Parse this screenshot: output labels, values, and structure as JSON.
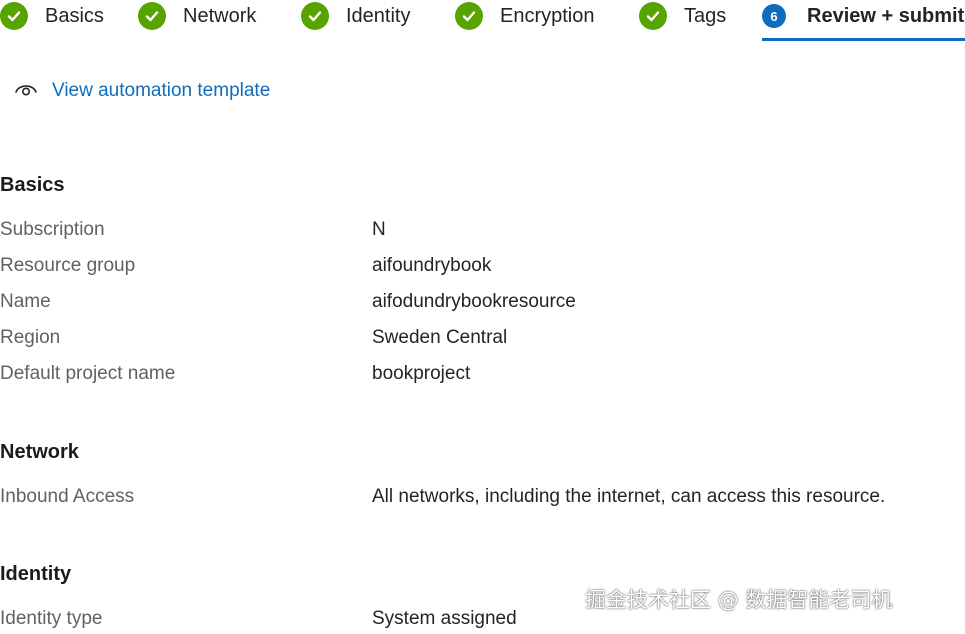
{
  "tabs": [
    {
      "label": "Basics",
      "status": "complete"
    },
    {
      "label": "Network",
      "status": "complete"
    },
    {
      "label": "Identity",
      "status": "complete"
    },
    {
      "label": "Encryption",
      "status": "complete"
    },
    {
      "label": "Tags",
      "status": "complete"
    },
    {
      "label": "Review + submit",
      "status": "active",
      "number": "6"
    }
  ],
  "automation_link": {
    "label": "View automation template",
    "icon": "eye-icon"
  },
  "sections": {
    "basics": {
      "title": "Basics",
      "rows": [
        {
          "label": "Subscription",
          "value": "N"
        },
        {
          "label": "Resource group",
          "value": "aifoundrybook"
        },
        {
          "label": "Name",
          "value": "aifodundrybookresource"
        },
        {
          "label": "Region",
          "value": "Sweden Central"
        },
        {
          "label": "Default project name",
          "value": "bookproject"
        }
      ]
    },
    "network": {
      "title": "Network",
      "rows": [
        {
          "label": "Inbound Access",
          "value": "All networks, including the internet, can access this resource."
        }
      ]
    },
    "identity": {
      "title": "Identity",
      "rows": [
        {
          "label": "Identity type",
          "value": "System assigned"
        }
      ]
    }
  },
  "watermark": "掘金技术社区 @ 数据智能老司机",
  "colors": {
    "complete": "#57a300",
    "accent": "#0f6cbd",
    "label": "#616161",
    "text": "#242424"
  }
}
